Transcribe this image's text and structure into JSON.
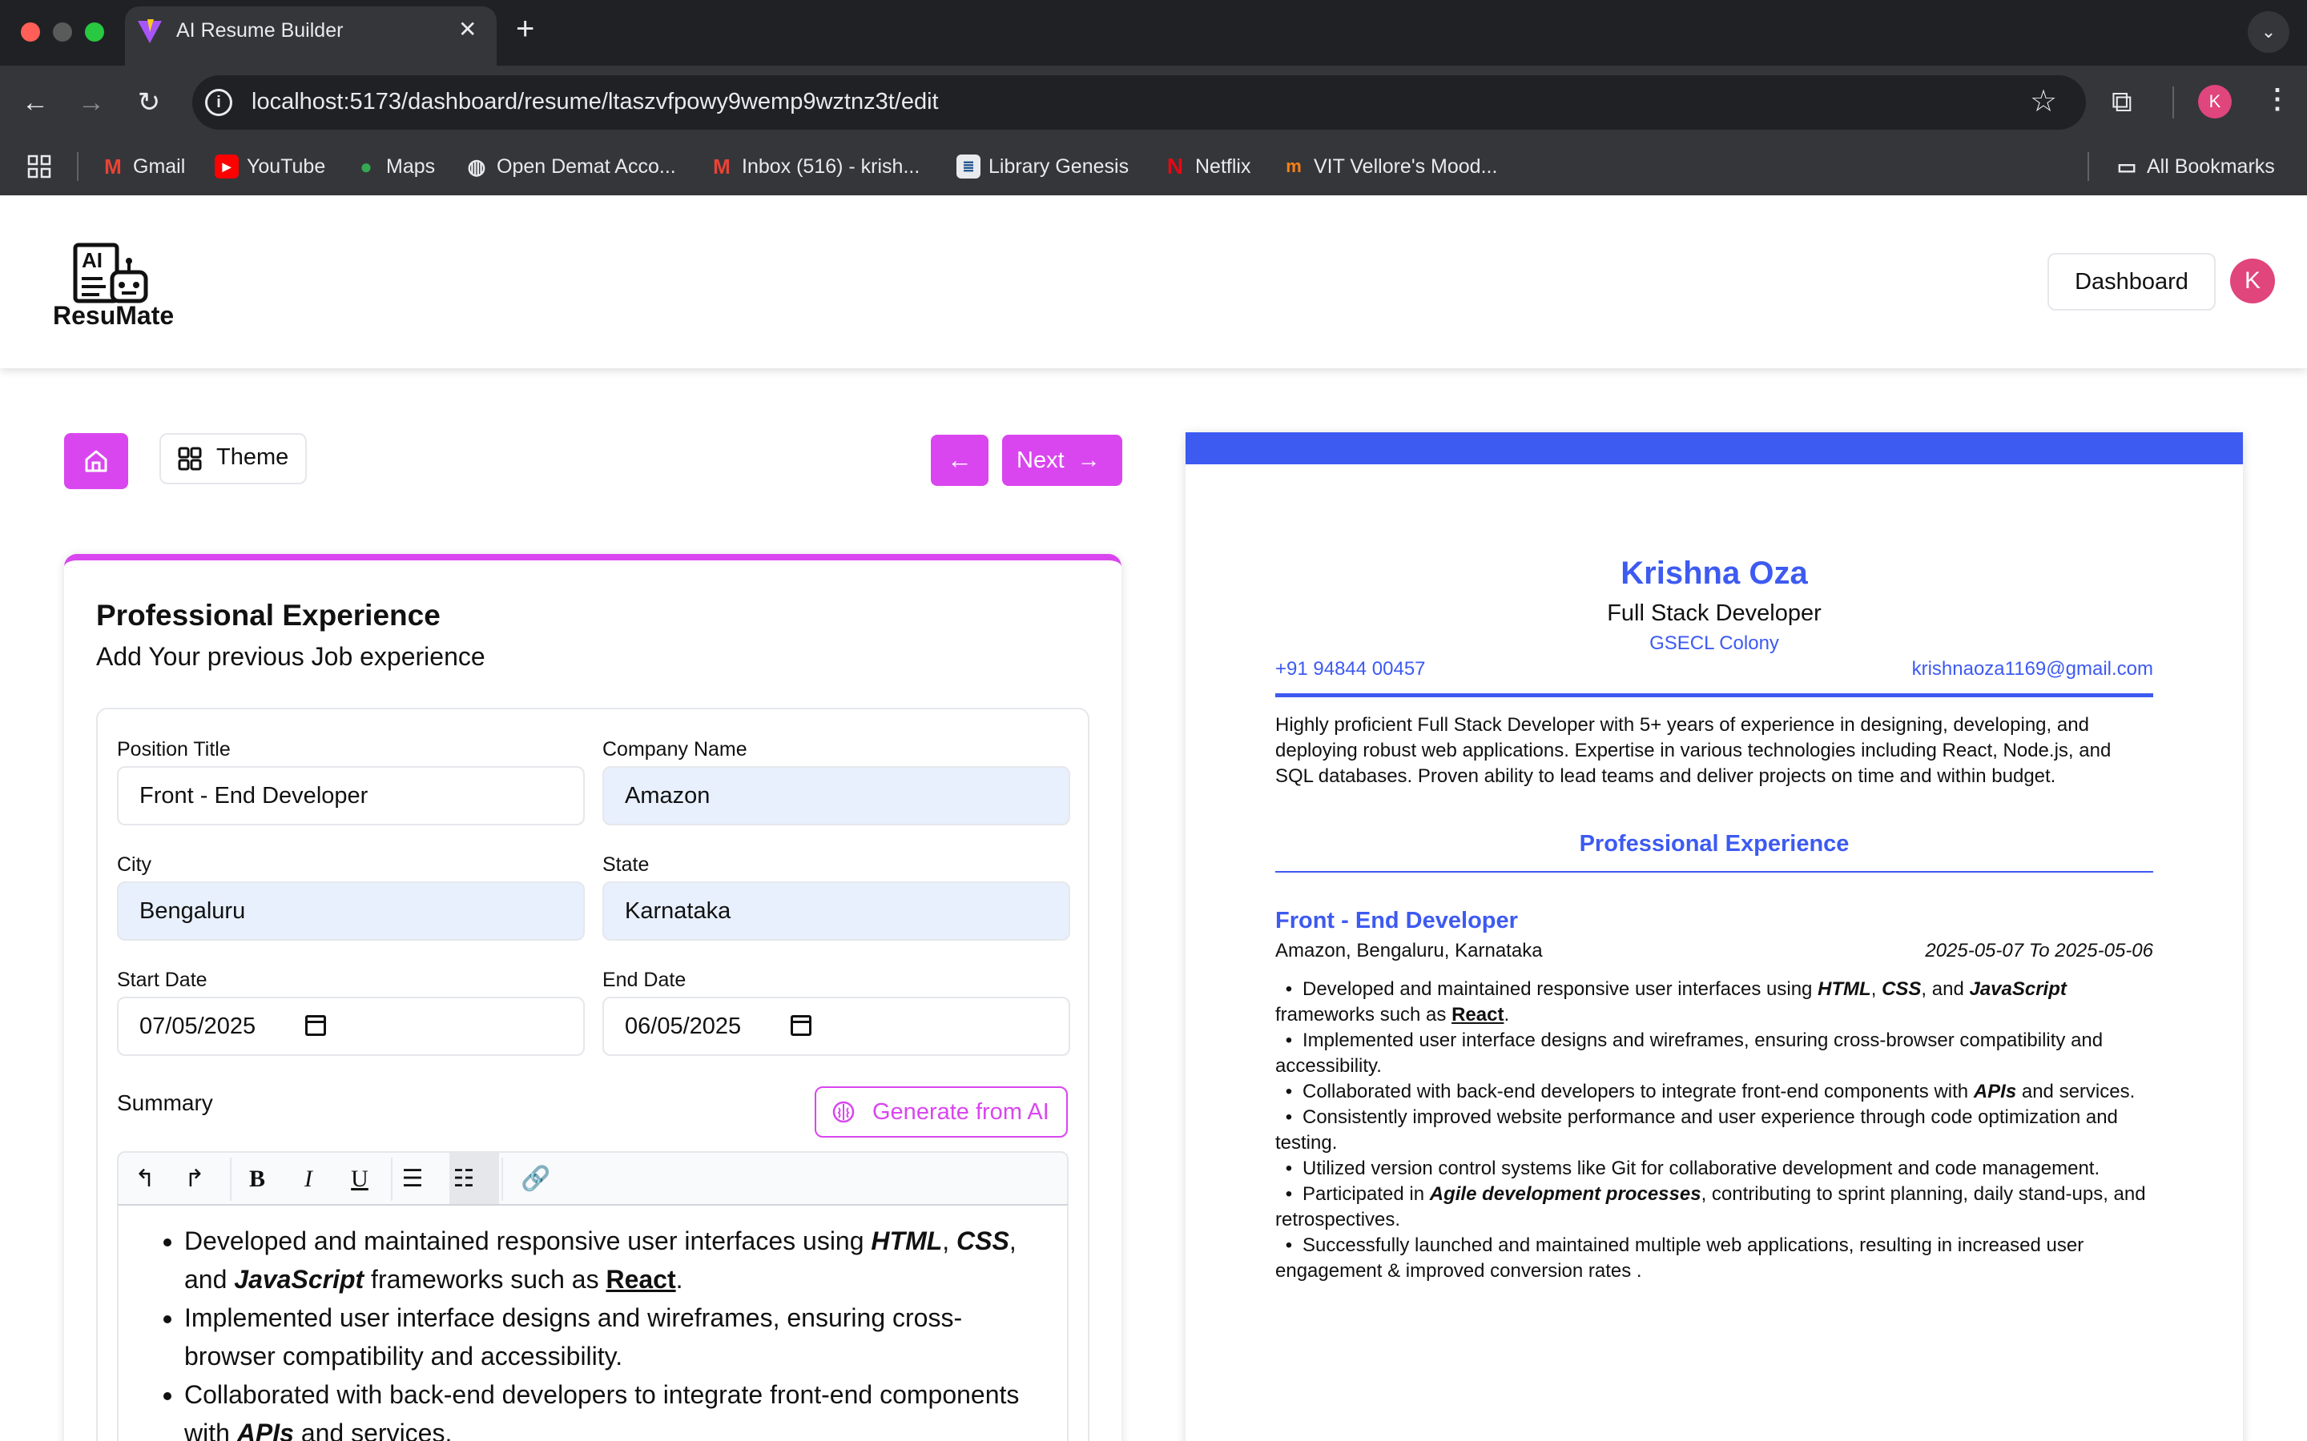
{
  "browser": {
    "tab_title": "AI Resume Builder",
    "url": "localhost:5173/dashboard/resume/ltaszvfpowy9wemp9wztnz3t/edit",
    "profile_initial": "K",
    "bookmarks": [
      "Gmail",
      "YouTube",
      "Maps",
      "Open Demat Acco...",
      "Inbox (516) - krish...",
      "Library Genesis",
      "Netflix",
      "VIT Vellore's Mood..."
    ],
    "all_bookmarks": "All Bookmarks"
  },
  "header": {
    "logo_text": "ResuMate",
    "dashboard_label": "Dashboard",
    "avatar_initial": "K"
  },
  "controls": {
    "theme_label": "Theme",
    "next_label": "Next"
  },
  "form": {
    "title": "Professional Experience",
    "subtitle": "Add Your previous Job experience",
    "position_label": "Position Title",
    "position_value": "Front - End Developer",
    "company_label": "Company Name",
    "company_value": "Amazon",
    "city_label": "City",
    "city_value": "Bengaluru",
    "state_label": "State",
    "state_value": "Karnataka",
    "start_label": "Start Date",
    "start_value": "07/05/2025",
    "end_label": "End Date",
    "end_value": "06/05/2025",
    "summary_label": "Summary",
    "generate_label": "Generate from AI"
  },
  "editor": {
    "bullet_1_pre": "Developed and maintained responsive user interfaces using ",
    "bullet_1_html": "HTML",
    "bullet_1_sep1": ", ",
    "bullet_1_css": "CSS",
    "bullet_1_sep2": ", and ",
    "bullet_1_js": "JavaScript",
    "bullet_1_mid": " frameworks such as ",
    "bullet_1_react": "React",
    "bullet_1_end": ".",
    "bullet_2": "Implemented user interface designs and wireframes, ensuring cross-browser compatibility and accessibility.",
    "bullet_3_pre": "Collaborated with back-end developers to integrate front-end components with ",
    "bullet_3_apis": "APIs",
    "bullet_3_end": " and services."
  },
  "resume": {
    "name": "Krishna Oza",
    "job_title": "Full Stack Developer",
    "address": "GSECL Colony",
    "phone": "+91 94844 00457",
    "email": "krishnaoza1169@gmail.com",
    "summary": "Highly proficient Full Stack Developer with 5+ years of experience in designing, developing, and deploying robust web applications. Expertise in various technologies including React, Node.js, and SQL databases. Proven ability to lead teams and deliver projects on time and within budget.",
    "section_title": "Professional Experience",
    "exp_title": "Front - End Developer",
    "exp_company": "Amazon, Bengaluru, Karnataka",
    "exp_dates": "2025-05-07 To 2025-05-06",
    "b1_pre": "Developed and maintained responsive user interfaces using ",
    "b1_html": "HTML",
    "b1_sep1": ", ",
    "b1_css": "CSS",
    "b1_sep2": ", and ",
    "b1_js": "JavaScript",
    "b1_mid": " frameworks such as ",
    "b1_react": "React",
    "b1_end": ".",
    "b2": "Implemented user interface designs and wireframes, ensuring cross-browser compatibility and accessibility.",
    "b3_pre": "Collaborated with back-end developers to integrate front-end components with ",
    "b3_apis": "APIs",
    "b3_end": " and services.",
    "b4": "Consistently improved website performance and user experience through code optimization and testing.",
    "b5": "Utilized version control systems like Git for collaborative development and code management.",
    "b6_pre": "Participated in ",
    "b6_bold": "Agile development processes",
    "b6_end": ", contributing to sprint planning, daily stand-ups, and retrospectives.",
    "b7": "Successfully launched and maintained multiple web applications, resulting in increased user engagement & improved conversion rates ."
  },
  "colors": {
    "accent": "#d946ef",
    "resume_blue": "#3d5af1",
    "avatar_pink": "#e0457b"
  }
}
